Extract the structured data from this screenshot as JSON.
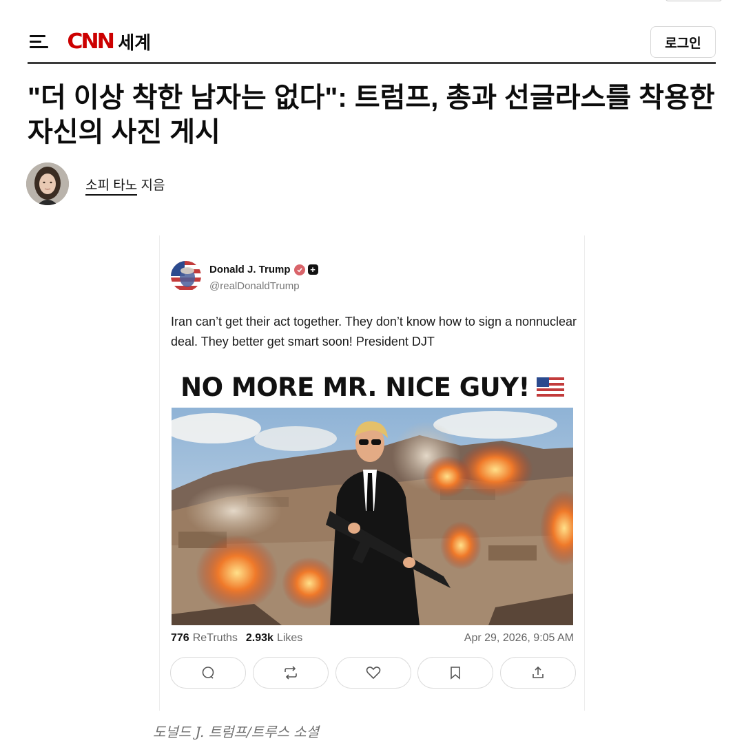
{
  "header": {
    "logo_text": "CNN",
    "section_label": "세계",
    "login_label": "로그인"
  },
  "article": {
    "headline": "\"더 이상 착한 남자는 없다\": 트럼프, 총과 선글라스를 착용한 자신의 사진 게시",
    "author_name": "소피 타노",
    "author_suffix": "지음"
  },
  "post": {
    "display_name": "Donald J. Trump",
    "handle": "@realDonaldTrump",
    "text": "Iran can’t get their act together. They don’t know how to sign a nonnuclear deal. They better get smart soon! President DJT",
    "image_heading": "NO MORE MR. NICE GUY!",
    "retruths_count": "776",
    "retruths_label": "ReTruths",
    "likes_count": "2.93k",
    "likes_label": "Likes",
    "timestamp": "Apr 29, 2026, 9:05 AM",
    "actions": [
      "reply-icon",
      "retruth-icon",
      "like-icon",
      "bookmark-icon",
      "share-icon"
    ]
  },
  "caption": "도널드 J. 트럼프/트루스 소셜",
  "colors": {
    "brand_red": "#cc0000",
    "verified": "#d9646a",
    "text_primary": "#0c0c0c",
    "text_muted": "#666666"
  }
}
